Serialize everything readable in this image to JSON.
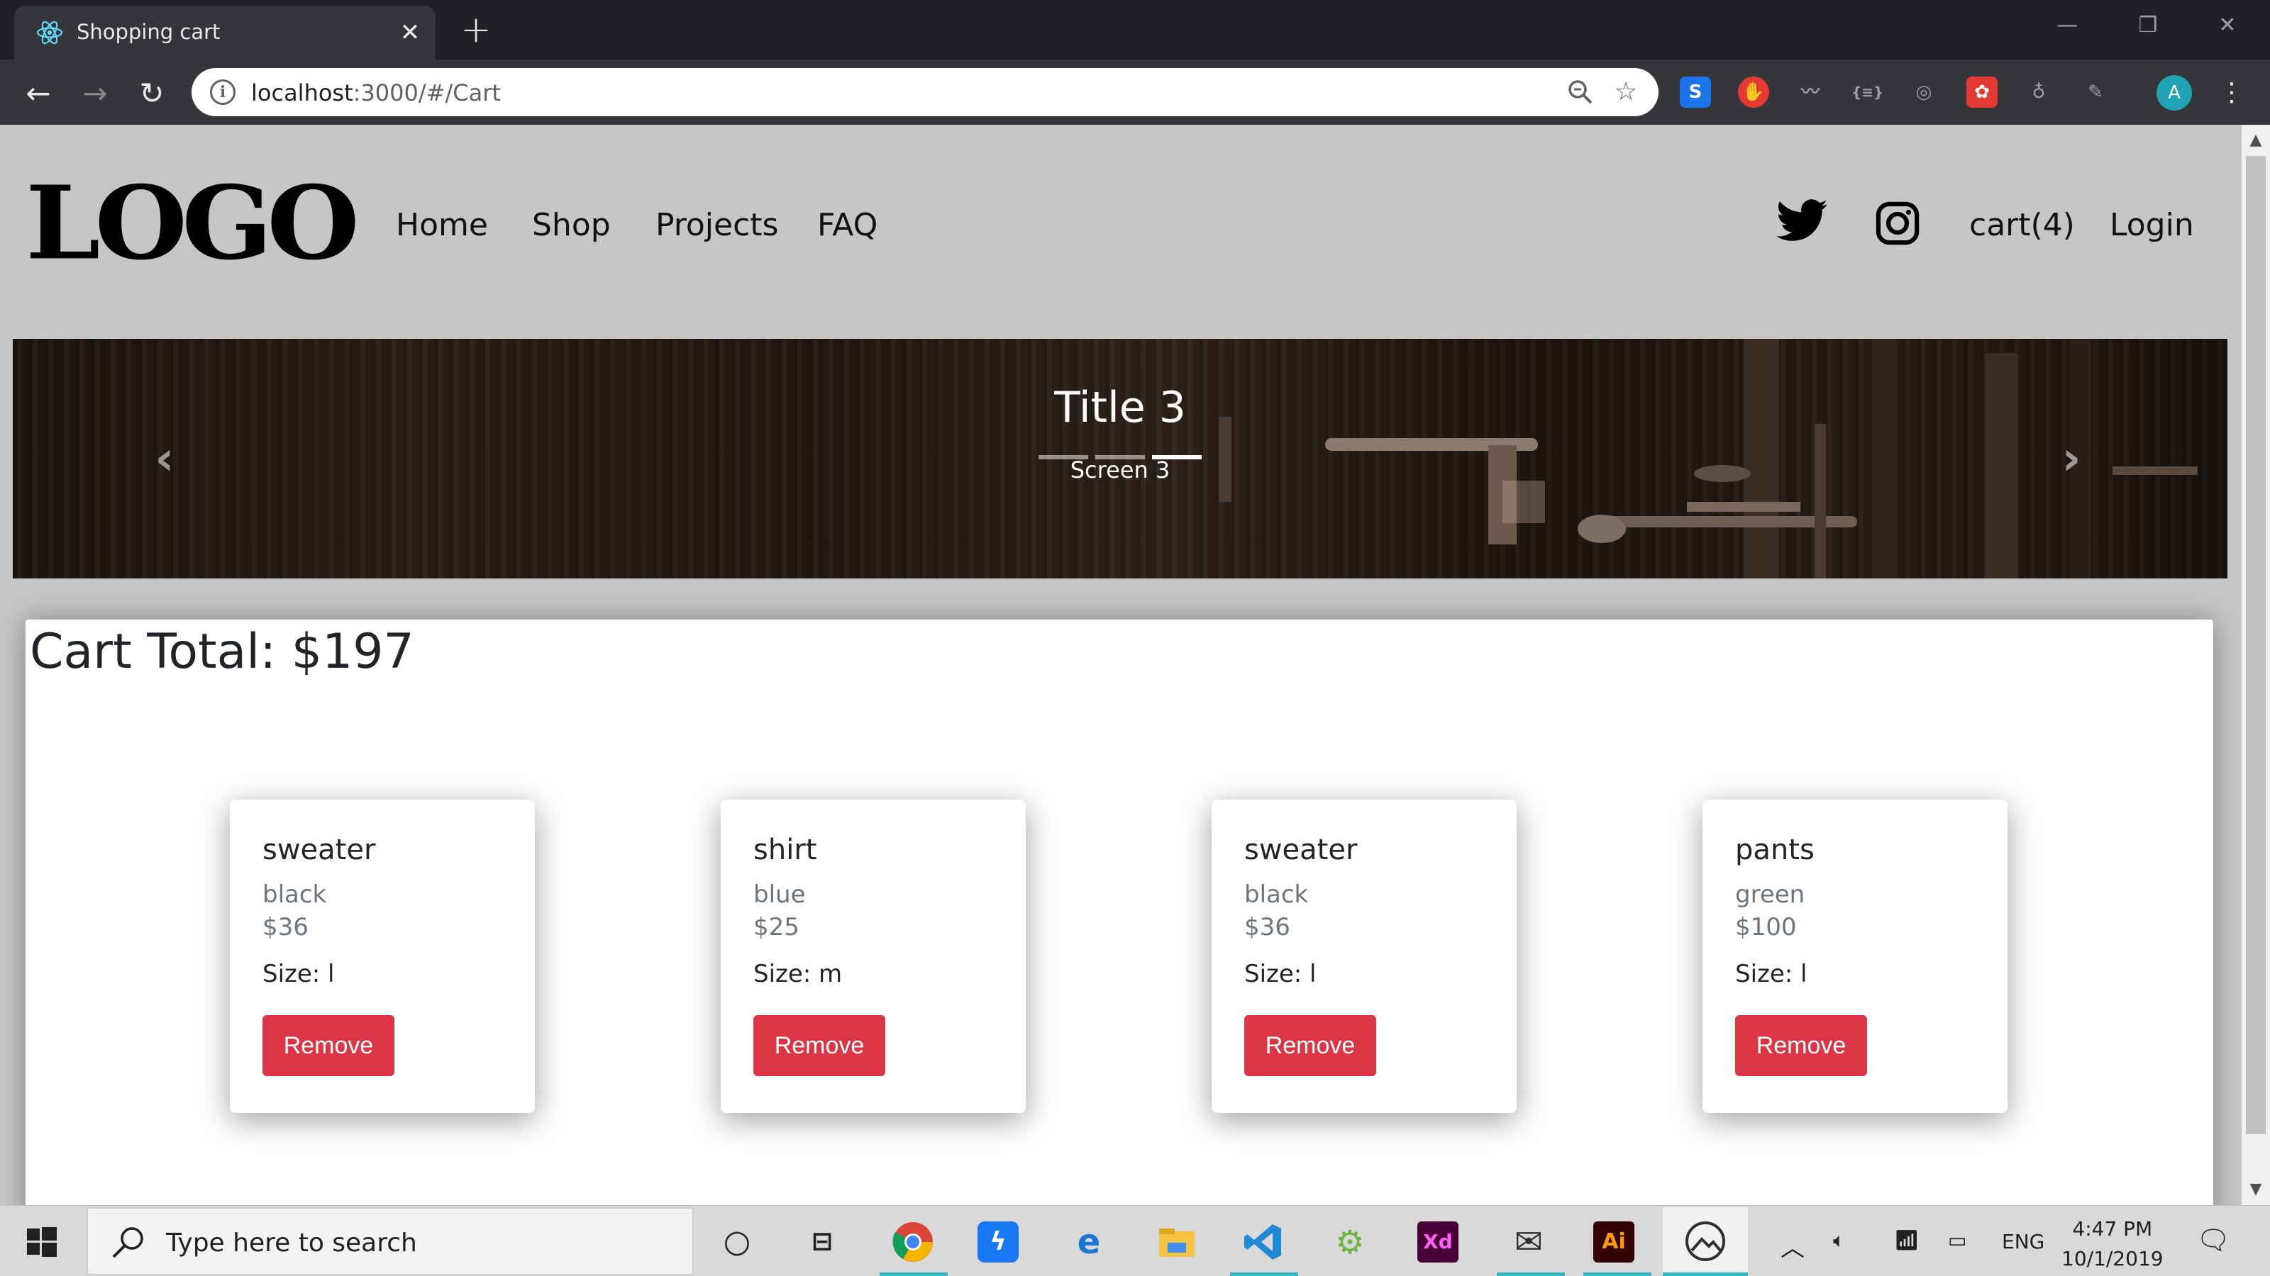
{
  "browser": {
    "tab_title": "Shopping cart",
    "tab_close": "✕",
    "new_tab": "+",
    "url_host": "localhost",
    "url_rest": ":3000/#/Cart",
    "window_controls": [
      "—",
      "❐",
      "✕"
    ],
    "profile_initial": "A",
    "extensions": [
      {
        "icon": "s-extension-icon",
        "label": "S",
        "color": "#1a73e8"
      },
      {
        "icon": "stop-hand-icon",
        "label": "✋",
        "color": "#e53935"
      },
      {
        "icon": "wave-icon",
        "label": "〰",
        "color": "#9aa0a6"
      },
      {
        "icon": "json-icon",
        "label": "{≡}",
        "color": "#9aa0a6"
      },
      {
        "icon": "lifebuoy-icon",
        "label": "◎",
        "color": "#9aa0a6"
      },
      {
        "icon": "paw-icon",
        "label": "✿",
        "color": "#e53935"
      },
      {
        "icon": "bulb-icon",
        "label": "♁",
        "color": "#9aa0a6"
      },
      {
        "icon": "pen-icon",
        "label": "✎",
        "color": "#9aa0a6"
      }
    ]
  },
  "site": {
    "logo": "LOGO",
    "nav": [
      "Home",
      "Shop",
      "Projects",
      "FAQ"
    ],
    "cart_link": "cart(4)",
    "login_link": "Login"
  },
  "carousel": {
    "title": "Title 3",
    "subtitle": "Screen 3",
    "prev": "‹",
    "next": "›",
    "slide_count": 3,
    "active_index": 2
  },
  "cart": {
    "total_label": "Cart Total: $197",
    "items": [
      {
        "name": "sweater",
        "color": "black",
        "price": "$36",
        "size": "Size: l",
        "button": "Remove"
      },
      {
        "name": "shirt",
        "color": "blue",
        "price": "$25",
        "size": "Size: m",
        "button": "Remove"
      },
      {
        "name": "sweater",
        "color": "black",
        "price": "$36",
        "size": "Size: l",
        "button": "Remove"
      },
      {
        "name": "pants",
        "color": "green",
        "price": "$100",
        "size": "Size: l",
        "button": "Remove"
      }
    ]
  },
  "taskbar": {
    "search_placeholder": "Type here to search",
    "language": "ENG",
    "time": "4:47 PM",
    "date": "10/1/2019",
    "accent": "#35b6c4"
  }
}
